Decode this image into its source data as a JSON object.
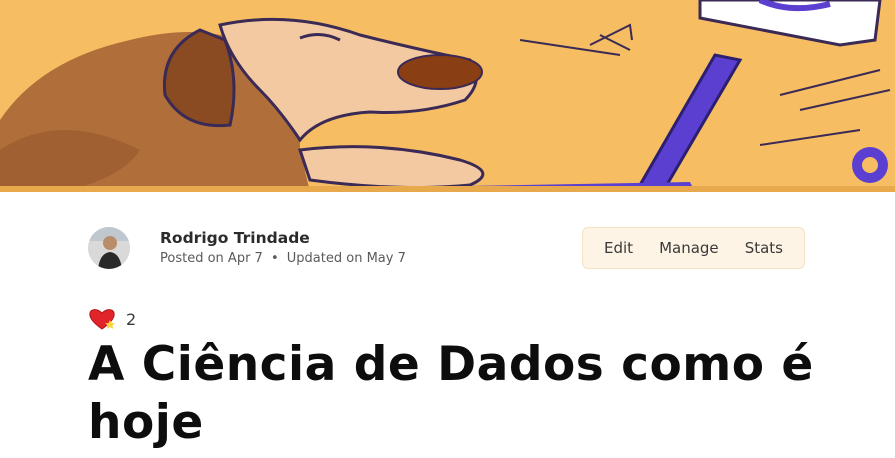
{
  "cover": {
    "alt_icon": "dog-with-laptop-illustration"
  },
  "author": {
    "name": "Rodrigo Trindade",
    "posted_label": "Posted on",
    "posted_date": "Apr 7",
    "separator": "•",
    "updated_label": "Updated on",
    "updated_date": "May 7"
  },
  "actions": {
    "edit": "Edit",
    "manage": "Manage",
    "stats": "Stats"
  },
  "reactions": {
    "icon": "heart-reaction-icon",
    "count": "2"
  },
  "article": {
    "title": "A Ciência de Dados como é hoje"
  }
}
